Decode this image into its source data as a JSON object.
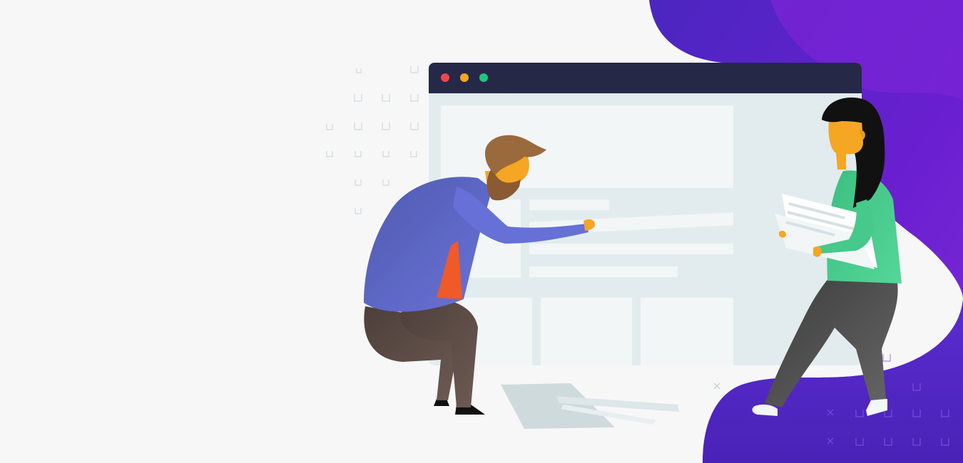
{
  "illustration": {
    "subject": "hero-illustration",
    "colors": {
      "background": "#f7f7f7",
      "blob_primary": "#5b2bc8",
      "blob_secondary": "#7a22d4",
      "browser_bar": "#262848",
      "browser_body": "#e2ecee",
      "browser_block": "#f2f6f7",
      "dot_red": "#f0464a",
      "dot_yellow": "#f5a623",
      "dot_green": "#1fc67e",
      "man_shirt": "#5563c1",
      "man_tie": "#f05a28",
      "man_pants": "#5e4d48",
      "man_hair": "#9b6a3c",
      "skin": "#f5a623",
      "woman_top": "#46c98b",
      "woman_pants": "#4a4a4a",
      "woman_hair": "#111111",
      "paper": "#f1f5f6"
    }
  }
}
